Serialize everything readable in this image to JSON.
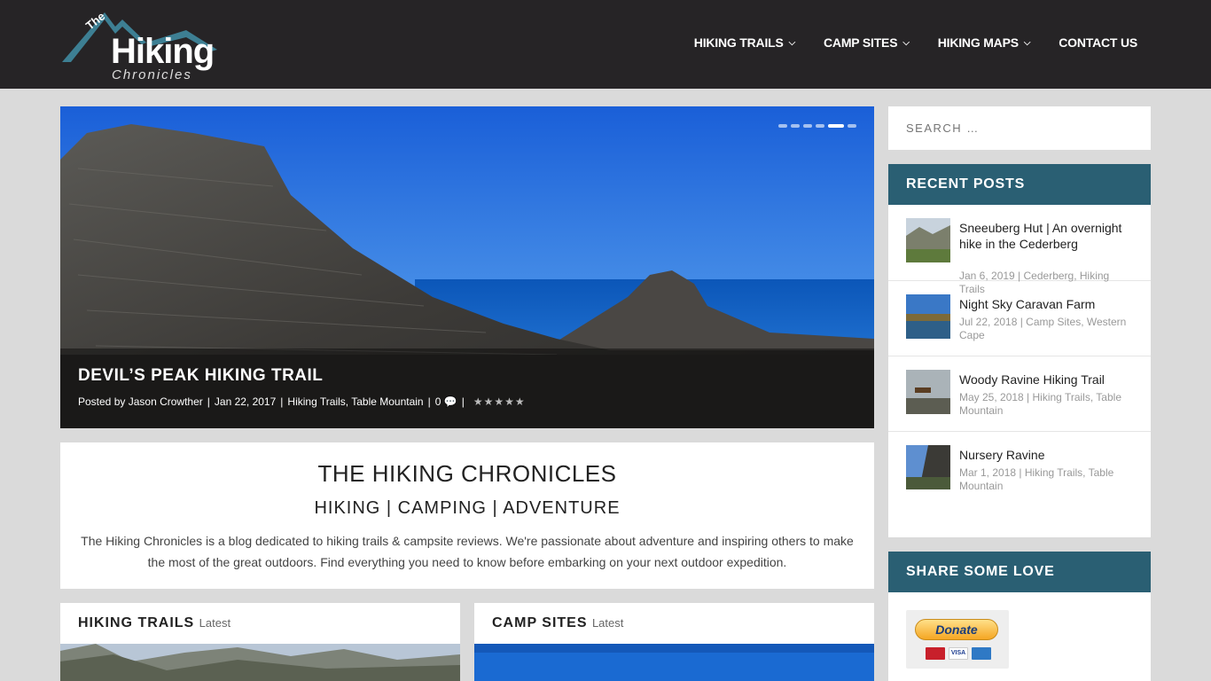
{
  "logo": {
    "the": "The",
    "main": "Hiking",
    "sub": "Chronicles"
  },
  "nav": [
    {
      "label": "HIKING TRAILS",
      "caret": "⌄"
    },
    {
      "label": "CAMP SITES",
      "caret": "⌄"
    },
    {
      "label": "HIKING MAPS",
      "caret": "⌄"
    },
    {
      "label": "CONTACT US"
    }
  ],
  "hero": {
    "title": "DEVIL’S PEAK HIKING TRAIL",
    "posted_by": "Posted by",
    "author": "Jason Crowther",
    "date": "Jan 22, 2017",
    "categories": "Hiking Trails, Table Mountain",
    "comments": "0",
    "stars": "★★★★★",
    "slides": 6,
    "active_slide": 5
  },
  "intro": {
    "title": "THE HIKING CHRONICLES",
    "tagline": "HIKING | CAMPING | ADVENTURE",
    "text": "The Hiking Chronicles is a blog dedicated to hiking trails & campsite reviews. We're passionate about adventure and inspiring others to make the most of the great outdoors. Find everything you need to know before embarking on your next outdoor expedition."
  },
  "sections": [
    {
      "title": "HIKING TRAILS",
      "latest": "Latest"
    },
    {
      "title": "CAMP SITES",
      "latest": "Latest"
    }
  ],
  "search": {
    "placeholder": "SEARCH …"
  },
  "recent_posts": {
    "title": "RECENT POSTS",
    "items": [
      {
        "title": "Sneeuberg Hut | An overnight hike in the Cederberg",
        "meta": "Jan 6, 2019 | Cederberg, Hiking Trails"
      },
      {
        "title": "Night Sky Caravan Farm",
        "meta": "Jul 22, 2018 | Camp Sites, Western Cape"
      },
      {
        "title": "Woody Ravine Hiking Trail",
        "meta": "May 25, 2018 | Hiking Trails, Table Mountain"
      },
      {
        "title": "Nursery Ravine",
        "meta": "Mar 1, 2018 | Hiking Trails, Table Mountain"
      }
    ]
  },
  "share": {
    "title": "SHARE SOME LOVE",
    "donate_label": "Donate",
    "cards": [
      "MC",
      "VISA",
      "AMEX"
    ]
  },
  "colors": {
    "header_bg": "#262426",
    "widget_head": "#2a5f73",
    "page_bg": "#dadada"
  }
}
